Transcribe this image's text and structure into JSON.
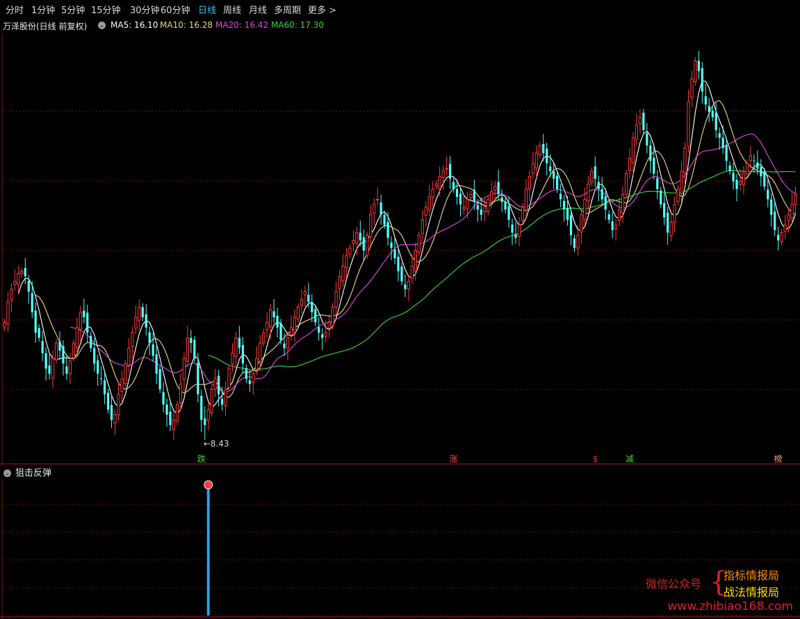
{
  "toolbar": {
    "items": [
      {
        "label": "分时",
        "active": false
      },
      {
        "label": "1分钟",
        "active": false
      },
      {
        "label": "5分钟",
        "active": false
      },
      {
        "label": "15分钟",
        "active": false
      },
      {
        "label": "30分钟",
        "active": false
      },
      {
        "label": "60分钟",
        "active": false
      },
      {
        "label": "日线",
        "active": true
      },
      {
        "label": "周线",
        "active": false
      },
      {
        "label": "月线",
        "active": false
      },
      {
        "label": "多周期",
        "active": false
      },
      {
        "label": "更多 >",
        "active": false
      }
    ]
  },
  "info": {
    "stock_title": "万泽股份(日线 前复权)",
    "settings_icon": "chevron-down-icon",
    "ma5": "MA5: 16.10",
    "ma10": "MA10: 16.28",
    "ma20": "MA20: 16.42",
    "ma60": "MA60: 17.30"
  },
  "colors": {
    "up": "#ff3b3b",
    "down": "#54ffff",
    "ma5": "#ffffff",
    "ma10": "#e8d87a",
    "ma20": "#e048e0",
    "ma60": "#3ad63a",
    "grid": "#7a1010",
    "active_tab": "#33c0ff"
  },
  "chart": {
    "low_label": "←8.43",
    "markers": [
      {
        "label": "跌",
        "color": "#3ad63a",
        "index": 57
      },
      {
        "label": "涨",
        "color": "#ff4d4d",
        "index": 130
      },
      {
        "label": "$",
        "color": "#ff2020",
        "index": 171
      },
      {
        "label": "减",
        "color": "#3ad63a",
        "index": 181
      },
      {
        "label": "榜",
        "color": "#ff9966",
        "index": 224
      }
    ]
  },
  "indicator": {
    "title": "狙击反弹",
    "signal_index": 59
  },
  "watermark": {
    "left": "微信公众号",
    "brace": "{",
    "line1": "指标情报局",
    "line2": "战法情报局",
    "url": "www.zhibiao168.com"
  },
  "chart_data": {
    "type": "candlestick",
    "title": "万泽股份(日线 前复权)",
    "min_price_label": 8.43,
    "ma_current": {
      "MA5": 16.1,
      "MA10": 16.28,
      "MA20": 16.42,
      "MA60": 17.3
    },
    "ylim": [
      8.0,
      24.0
    ],
    "close": [
      13.0,
      13.8,
      14.3,
      14.6,
      14.9,
      15.0,
      14.8,
      14.2,
      13.4,
      12.6,
      12.4,
      11.8,
      11.2,
      11.0,
      11.6,
      12.2,
      11.9,
      11.4,
      11.0,
      11.5,
      12.2,
      12.8,
      13.4,
      13.2,
      12.6,
      12.0,
      11.4,
      11.0,
      10.8,
      10.2,
      9.6,
      9.2,
      9.4,
      10.2,
      10.8,
      11.4,
      12.0,
      12.6,
      13.2,
      13.6,
      13.2,
      12.8,
      12.2,
      11.7,
      11.0,
      10.4,
      9.8,
      9.4,
      9.0,
      9.2,
      9.8,
      10.6,
      11.6,
      12.4,
      12.2,
      11.6,
      10.2,
      9.2,
      9.0,
      9.6,
      10.4,
      10.8,
      10.2,
      9.8,
      10.4,
      11.2,
      11.8,
      12.4,
      12.0,
      11.4,
      10.8,
      10.6,
      11.0,
      11.6,
      12.2,
      12.6,
      13.0,
      13.5,
      13.2,
      12.8,
      12.3,
      12.0,
      12.4,
      12.8,
      13.2,
      13.6,
      13.9,
      14.2,
      13.8,
      13.4,
      13.0,
      12.6,
      12.4,
      12.6,
      13.0,
      13.6,
      14.2,
      14.8,
      15.2,
      15.6,
      15.9,
      16.2,
      16.5,
      16.2,
      15.8,
      16.4,
      17.2,
      17.6,
      17.8,
      17.2,
      16.8,
      16.3,
      15.9,
      15.5,
      15.0,
      14.6,
      14.3,
      14.6,
      15.2,
      15.8,
      16.4,
      17.0,
      17.5,
      17.9,
      18.2,
      18.4,
      18.7,
      18.9,
      19.0,
      18.6,
      18.2,
      17.9,
      17.6,
      17.5,
      17.8,
      18.0,
      17.7,
      17.4,
      17.2,
      17.5,
      17.8,
      18.1,
      18.3,
      18.0,
      17.7,
      17.4,
      17.0,
      16.5,
      16.3,
      16.8,
      17.5,
      18.2,
      18.7,
      19.2,
      19.6,
      19.9,
      19.6,
      19.2,
      18.9,
      18.6,
      18.2,
      17.8,
      17.4,
      17.0,
      16.4,
      15.9,
      16.4,
      17.2,
      17.8,
      18.4,
      18.9,
      18.6,
      18.2,
      17.8,
      17.4,
      17.0,
      16.6,
      16.8,
      17.4,
      18.0,
      18.8,
      19.4,
      20.2,
      20.7,
      21.0,
      20.5,
      19.9,
      19.3,
      18.8,
      18.2,
      17.6,
      17.1,
      16.5,
      16.9,
      17.6,
      18.2,
      18.9,
      19.8,
      21.6,
      22.5,
      23.2,
      22.8,
      22.0,
      21.5,
      21.2,
      21.0,
      20.5,
      20.2,
      19.8,
      19.3,
      18.9,
      18.5,
      18.2,
      18.5,
      18.8,
      19.2,
      19.5,
      19.3,
      19.0,
      18.7,
      18.3,
      17.8,
      17.2,
      16.6,
      16.2,
      16.5,
      16.8,
      17.2,
      17.6,
      18.0
    ],
    "series_note_absent": true
  }
}
